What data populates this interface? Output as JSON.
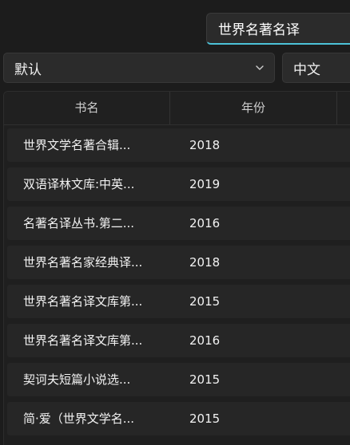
{
  "search": {
    "value": "世界名著名译"
  },
  "filters": {
    "sort_selected": "默认",
    "language_selected": "中文"
  },
  "table": {
    "columns": [
      "书名",
      "年份"
    ],
    "rows": [
      {
        "name": "世界文学名著合辑...",
        "year": "2018"
      },
      {
        "name": "双语译林文库:中英...",
        "year": "2019"
      },
      {
        "name": "名著名译丛书.第二...",
        "year": "2016"
      },
      {
        "name": "世界名著名家经典译...",
        "year": "2018"
      },
      {
        "name": "世界名著名译文库第...",
        "year": "2015"
      },
      {
        "name": "世界名著名译文库第...",
        "year": "2016"
      },
      {
        "name": "契诃夫短篇小说选...",
        "year": "2015"
      },
      {
        "name": "简·爱（世界文学名...",
        "year": "2015"
      }
    ]
  },
  "icons": {
    "dropdown": "chevron-down-icon"
  }
}
